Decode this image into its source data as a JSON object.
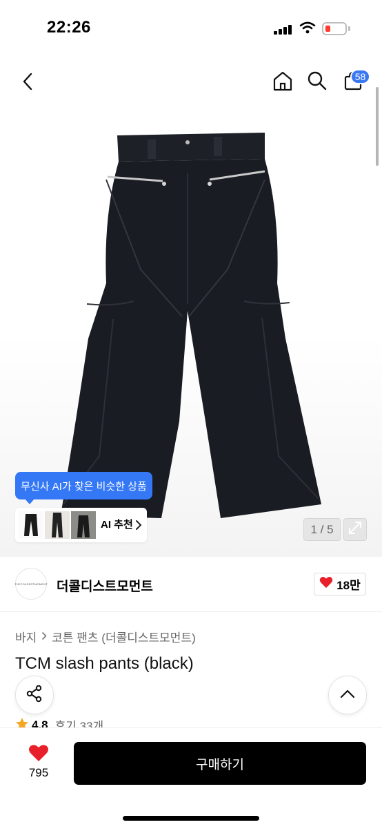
{
  "status": {
    "time": "22:26"
  },
  "header": {
    "back_icon": "chevron-left-icon",
    "home_icon": "home-icon",
    "search_icon": "search-icon",
    "cart_icon": "shopping-bag-icon",
    "cart_count": "58"
  },
  "gallery": {
    "counter": "1 / 5",
    "expand_icon": "expand-icon",
    "ai_tooltip": "무신사 AI가 찾은 비슷한 상품",
    "ai_button_label": "AI 추천"
  },
  "brand": {
    "name": "더콜디스트모먼트",
    "logo_text": "THECOLDESTMOMENT",
    "like_count": "18만"
  },
  "breadcrumb": {
    "items": [
      "바지",
      "코튼 팬츠 (더콜디스트모먼트)"
    ]
  },
  "product": {
    "title": "TCM slash pants (black)",
    "rating": "4.8",
    "reviews": "후기 33개"
  },
  "bottom": {
    "wish_count": "795",
    "buy_label": "구매하기"
  },
  "colors": {
    "accent_blue": "#3478f6",
    "heart_red": "#e8202a",
    "star_yellow": "#f5a623",
    "buy_button": "#000000"
  }
}
